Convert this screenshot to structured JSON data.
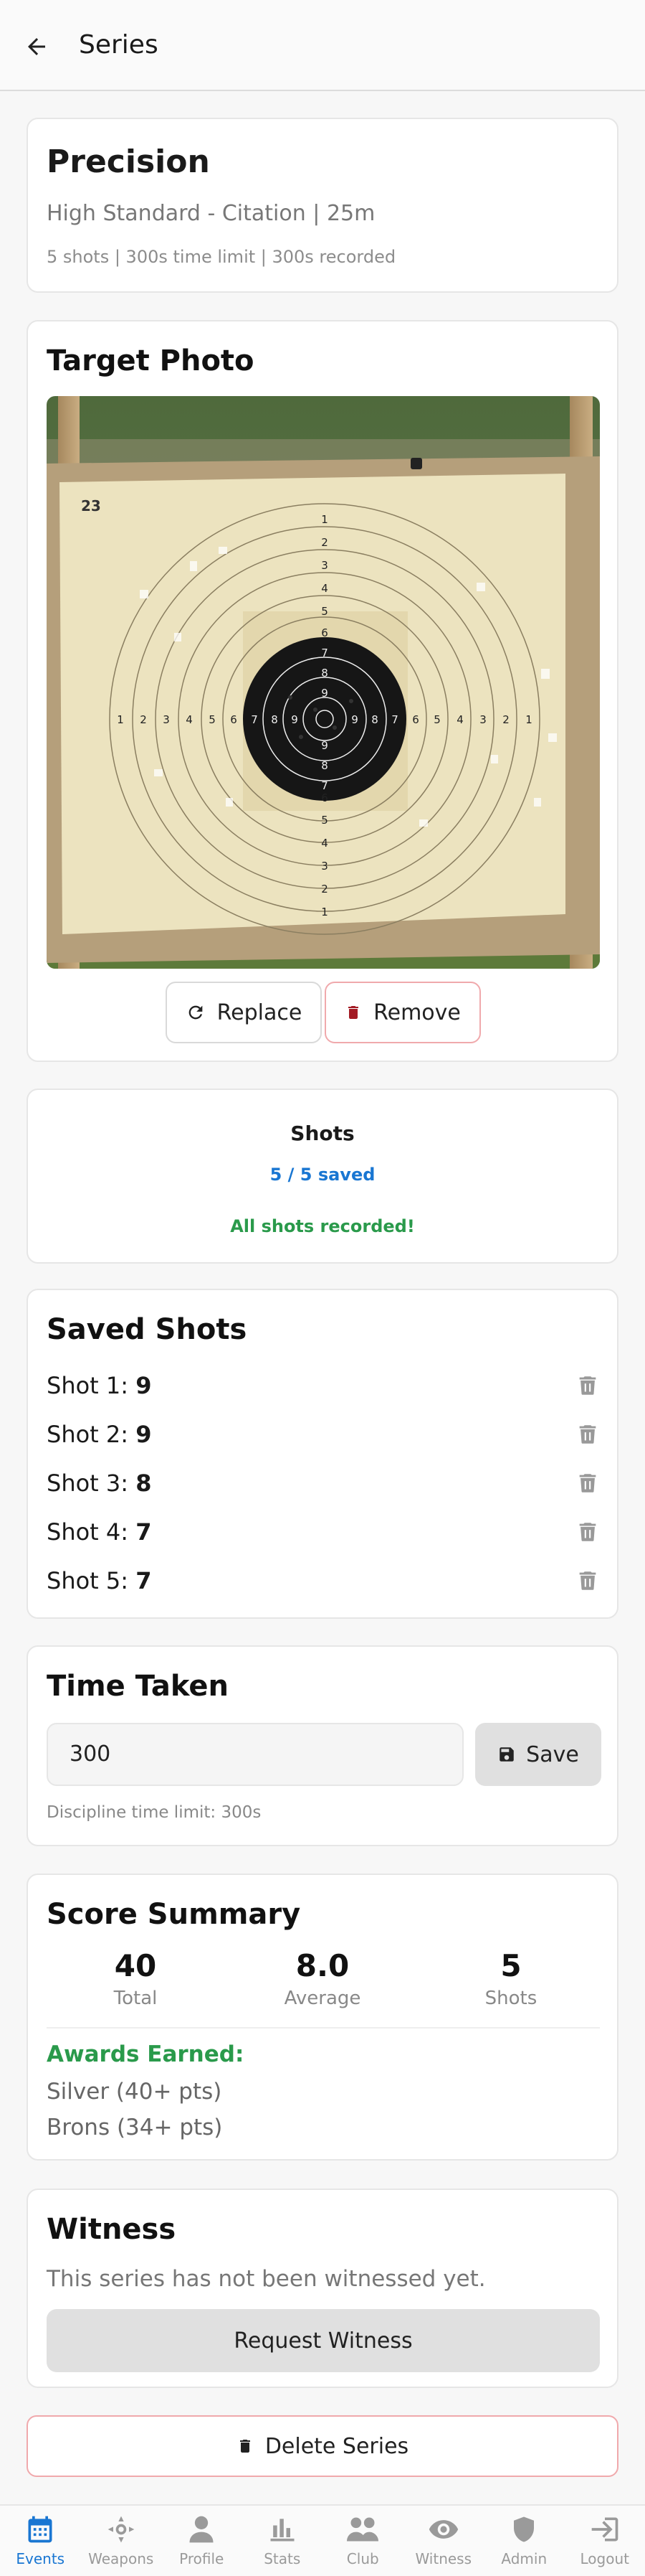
{
  "header": {
    "title": "Series"
  },
  "discipline": {
    "title": "Precision",
    "subtitle": "High Standard - Citation | 25m",
    "meta": "5 shots | 300s time limit | 300s recorded"
  },
  "photo": {
    "heading": "Target Photo",
    "target_number": "23",
    "ring_numbers": [
      "1",
      "2",
      "3",
      "4",
      "5",
      "6",
      "7",
      "8",
      "9"
    ],
    "replace_label": "Replace",
    "remove_label": "Remove"
  },
  "shots": {
    "heading": "Shots",
    "saved_text": "5 / 5 saved",
    "status_text": "All shots recorded!"
  },
  "saved_shots": {
    "heading": "Saved Shots",
    "items": [
      {
        "label": "Shot 1:",
        "value": "9"
      },
      {
        "label": "Shot 2:",
        "value": "9"
      },
      {
        "label": "Shot 3:",
        "value": "8"
      },
      {
        "label": "Shot 4:",
        "value": "7"
      },
      {
        "label": "Shot 5:",
        "value": "7"
      }
    ]
  },
  "time": {
    "heading": "Time Taken",
    "value": "300",
    "save_label": "Save",
    "hint": "Discipline time limit: 300s"
  },
  "summary": {
    "heading": "Score Summary",
    "total_value": "40",
    "total_label": "Total",
    "average_value": "8.0",
    "average_label": "Average",
    "shots_value": "5",
    "shots_label": "Shots",
    "awards_heading": "Awards Earned:",
    "awards": [
      "Silver (40+ pts)",
      "Brons (34+ pts)"
    ]
  },
  "witness": {
    "heading": "Witness",
    "message": "This series has not been witnessed yet.",
    "request_label": "Request Witness"
  },
  "delete_label": "Delete Series",
  "nav": [
    {
      "label": "Events",
      "icon": "calendar-icon",
      "active": true
    },
    {
      "label": "Weapons",
      "icon": "crosshair-icon",
      "active": false
    },
    {
      "label": "Profile",
      "icon": "user-icon",
      "active": false
    },
    {
      "label": "Stats",
      "icon": "bar-chart-icon",
      "active": false
    },
    {
      "label": "Club",
      "icon": "users-icon",
      "active": false
    },
    {
      "label": "Witness",
      "icon": "eye-icon",
      "active": false
    },
    {
      "label": "Admin",
      "icon": "shield-icon",
      "active": false
    },
    {
      "label": "Logout",
      "icon": "logout-icon",
      "active": false
    }
  ],
  "colors": {
    "accent": "#1976d2",
    "success": "#2a9a4b",
    "danger_border": "#f0a9ac"
  }
}
